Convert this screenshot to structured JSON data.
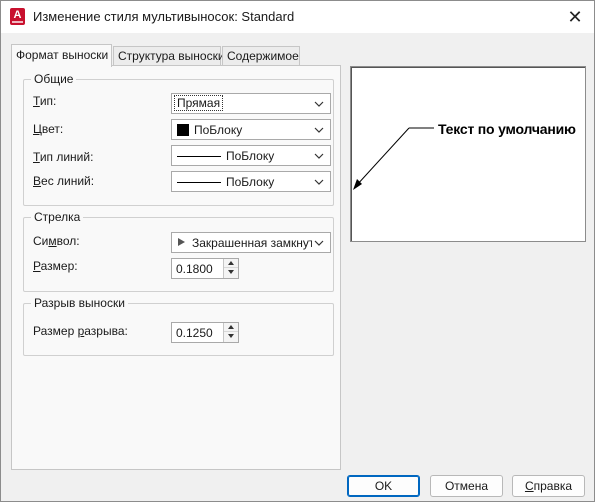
{
  "window": {
    "title": "Изменение стиля мультивыносок: Standard",
    "app_icon_letter": "A",
    "close_glyph": "✕"
  },
  "tabs": [
    {
      "label": "Формат выноски",
      "active": true
    },
    {
      "label": "Структура выноски",
      "active": false
    },
    {
      "label": "Содержимое",
      "active": false
    }
  ],
  "general": {
    "legend": "Общие",
    "type": {
      "label_u": "Т",
      "label_rest": "ип:",
      "value": "Прямая"
    },
    "color": {
      "label_u": "Ц",
      "label_rest": "вет:",
      "value": "ПоБлоку",
      "swatch": "#000000"
    },
    "linetype": {
      "label_u": "Т",
      "label_rest": "ип линий:",
      "value": "ПоБлоку"
    },
    "lineweight": {
      "label_u": "В",
      "label_rest": "ес линий:",
      "value": "ПоБлоку"
    }
  },
  "arrowhead": {
    "legend": "Стрелка",
    "symbol": {
      "label_pre": "Си",
      "label_u": "м",
      "label_rest": "вол:",
      "value": "Закрашенная замкнутая"
    },
    "size": {
      "label_u": "Р",
      "label_rest": "азмер:",
      "value": "0.1800"
    }
  },
  "leader_break": {
    "legend": "Разрыв выноски",
    "break_size": {
      "label_pre": "Размер ",
      "label_u": "р",
      "label_rest": "азрыва:",
      "value": "0.1250"
    }
  },
  "preview": {
    "text": "Текст по умолчанию"
  },
  "buttons": {
    "ok": "OK",
    "cancel": "Отмена",
    "help_u": "С",
    "help_rest": "правка"
  },
  "colors": {
    "accent": "#0067c0",
    "app_icon": "#c8102e"
  }
}
